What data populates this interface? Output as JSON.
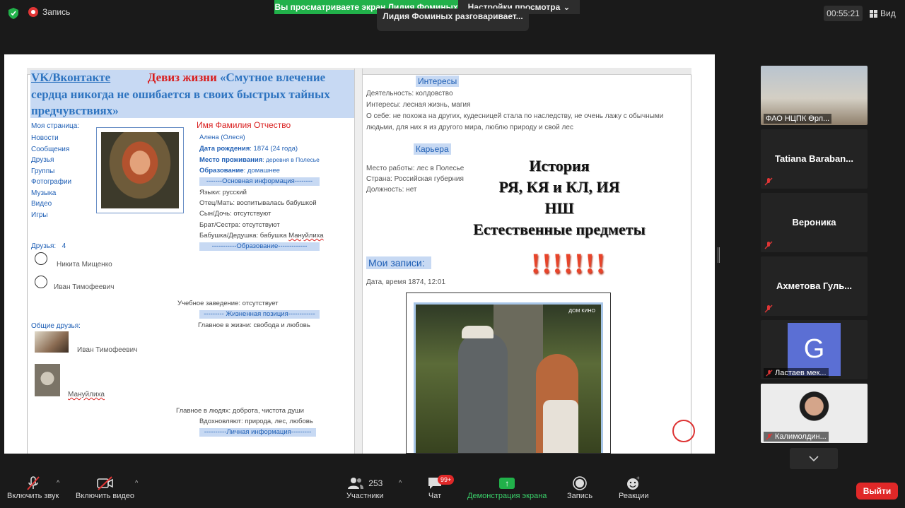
{
  "topbar": {
    "recording_label": "Запись",
    "share_banner": "Вы просматриваете экран Лидия Фоминых",
    "view_options": "Настройки просмотра",
    "talking": "Лидия Фоминых разговаривает...",
    "timer": "00:55:21",
    "view_label": "Вид"
  },
  "doc": {
    "motto_line1_prefix": "VK/Вконтакте",
    "motto_line1_red": "Девиз жизни",
    "motto_line1_rest": "«Смутное влечение",
    "motto_line2": "сердца никогда не ошибается в своих быстрых тайных предчувствиях»",
    "my_page": "Моя страница:",
    "nav": [
      "Новости",
      "Сообщения",
      "Друзья",
      "Группы",
      "Фотографии",
      "Музыка",
      "Видео",
      "Игры"
    ],
    "fio": "Имя Фамилия Отчество",
    "name": "Алена (Олеся)",
    "birth_label": "Дата рождения",
    "birth_value": ": 1874 (24 года)",
    "residence_label": "Место проживания",
    "residence_value": ": деревня в Полесье",
    "education_label": "Образование",
    "education_value": ": домашнее",
    "basic_info_band": "-------Основная информация--------",
    "languages": "Языки: русский",
    "parents": "Отец/Мать: воспитывалась бабушкой",
    "siblings1": "Сын/Дочь: отсутствуют",
    "siblings2": "Брат/Сестра: отсутствуют",
    "grandparents_prefix": "Бабушка/Дедушка: бабушка ",
    "grandparents_name": "Мануйлиха",
    "education_band": "-----------Образование-------------",
    "friends_label": "Друзья:",
    "friends_count": "4",
    "friend1": "Никита Мищенко",
    "friend2": "Иван Тимофеевич",
    "school": "Учебное заведение: отсутствует",
    "life_band": "--------- Жизненная позиция------------",
    "life_main": "Главное в жизни: свобода и любовь",
    "common_friends": "Общие друзья:",
    "common1": "Иван Тимофеевич",
    "common2": "Мануйлиха",
    "people_main": "Главное в людях: доброта, чистота души",
    "inspires": "Вдохновляют: природа, лес, любовь",
    "personal_band": "----------Личная информация---------",
    "interests_head": "Интересы",
    "activity": "Деятельность: колдовство",
    "interests": "Интересы: лесная жизнь, магия",
    "about1": "О себе: не похожа на других, кудесницей стала по наследству, не очень лажу с обычными",
    "about2": "людьми, для них я из другого мира, люблю природу и свой лес",
    "career_head": "Карьера",
    "work": "Место работы:  лес в Полесье",
    "country": "Страна: Российская губерния",
    "position": "Должность: нет",
    "posts_head": "Мои записи:",
    "post_date": "Дата, время 1874, 12:01",
    "video_logo": "ДОМ КИНО",
    "overlay_lines": [
      "История",
      "РЯ, КЯ и КЛ, ИЯ",
      "НШ",
      "Естественные предметы"
    ],
    "exclamations": "!!!!!!!"
  },
  "participants": [
    {
      "label": "ФАО НЦПК Өрл...",
      "kind": "room"
    },
    {
      "label": "Tatiana  Baraban...",
      "kind": "name"
    },
    {
      "label": "Вероника",
      "kind": "name"
    },
    {
      "label": "Ахметова  Гуль...",
      "kind": "name"
    },
    {
      "label": "Ластаев мек...",
      "kind": "avatar",
      "avatar_letter": "G"
    },
    {
      "label": "Калимолдин...",
      "kind": "face"
    }
  ],
  "toolbar": {
    "audio": "Включить звук",
    "video": "Включить видео",
    "participants_count": "253",
    "participants": "Участники",
    "chat": "Чат",
    "chat_badge": "99+",
    "share": "Демонстрация экрана",
    "record": "Запись",
    "reactions": "Реакции",
    "leave": "Выйти"
  },
  "colors": {
    "share_green": "#21b14a",
    "leave_red": "#e02828",
    "avatar_blue": "#5b6fd4",
    "doc_blue": "#1f5fb5"
  }
}
